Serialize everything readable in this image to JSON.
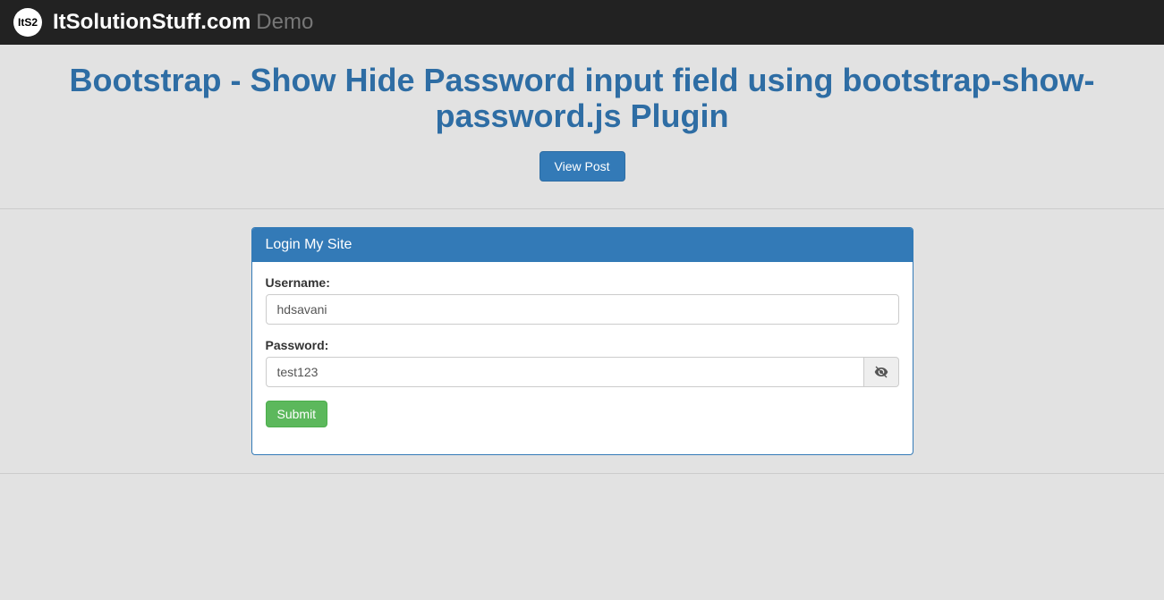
{
  "navbar": {
    "logo_text": "ItS2",
    "brand_main": "ItSolutionStuff.com",
    "brand_suffix": "Demo"
  },
  "header": {
    "title": "Bootstrap - Show Hide Password input field using bootstrap-show-password.js Plugin",
    "view_post_label": "View Post"
  },
  "panel": {
    "heading": "Login My Site",
    "username_label": "Username:",
    "username_value": "hdsavani",
    "password_label": "Password:",
    "password_value": "test123",
    "submit_label": "Submit"
  }
}
